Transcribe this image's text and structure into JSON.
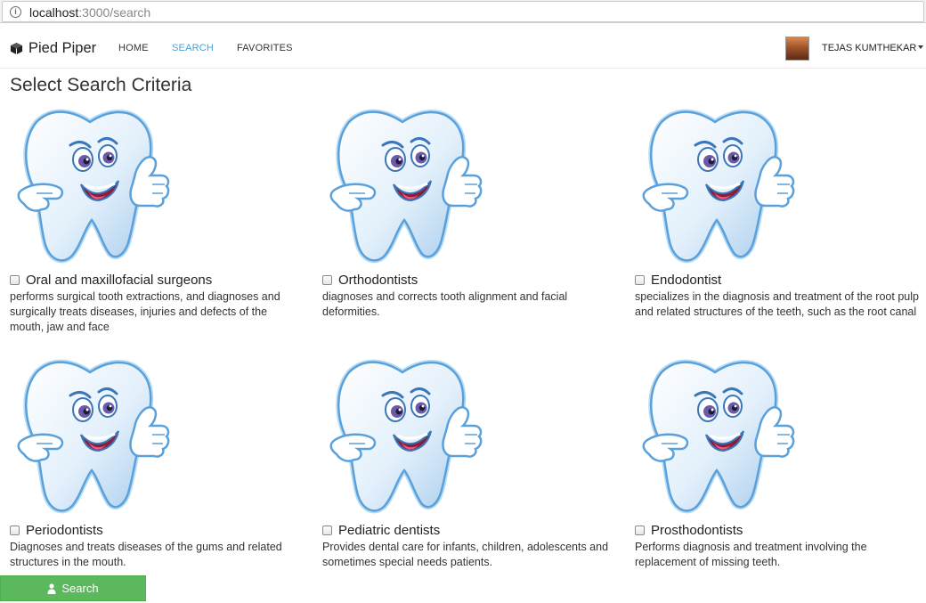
{
  "browser": {
    "url_host": "localhost",
    "url_path": ":3000/search"
  },
  "navbar": {
    "brand": "Pied Piper",
    "brand_icon": "cube-icon",
    "links": [
      "HOME",
      "SEARCH",
      "FAVORITES"
    ],
    "active_link": "SEARCH",
    "user_name": "TEJAS KUMTHEKAR",
    "accent_color": "#4a9fd5"
  },
  "page": {
    "title": "Select Search Criteria"
  },
  "specialties": [
    {
      "name": "Oral and maxillofacial surgeons",
      "description": "performs surgical tooth extractions, and diagnoses and surgically treats diseases, injuries and defects of the mouth, jaw and face",
      "checked": false
    },
    {
      "name": "Orthodontists",
      "description": "diagnoses and corrects tooth alignment and facial deformities.",
      "checked": false
    },
    {
      "name": "Endodontist",
      "description": "specializes in the diagnosis and treatment of the root pulp and related structures of the teeth, such as the root canal",
      "checked": false
    },
    {
      "name": "Periodontists",
      "description": "Diagnoses and treats diseases of the gums and related structures in the mouth.",
      "checked": false
    },
    {
      "name": "Pediatric dentists",
      "description": "Provides dental care for infants, children, adolescents and sometimes special needs patients.",
      "checked": false
    },
    {
      "name": "Prosthodontists",
      "description": "Performs diagnosis and treatment involving the replacement of missing teeth.",
      "checked": false
    }
  ],
  "search_button": {
    "label": "Search",
    "icon": "user-icon",
    "color": "#5cb85c"
  }
}
